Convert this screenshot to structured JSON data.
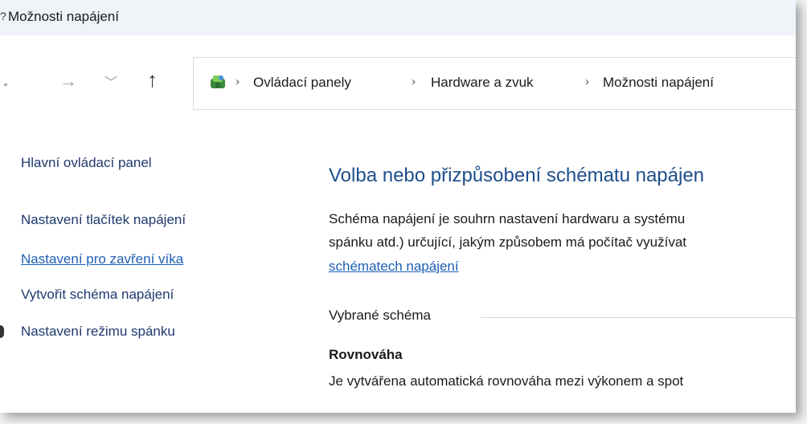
{
  "window": {
    "title": "Možnosti napájení"
  },
  "nav": {
    "back": "←",
    "forward": "→",
    "recent": "﹀",
    "up": "↑"
  },
  "breadcrumb": {
    "items": [
      "Ovládací panely",
      "Hardware a zvuk",
      "Možnosti napájení"
    ],
    "separator": "›"
  },
  "sidebar": {
    "items": [
      {
        "label": "Hlavní ovládací panel"
      },
      {
        "label": "Nastavení tlačítek napájení"
      },
      {
        "label": "Nastavení pro zavření víka"
      },
      {
        "label": "Vytvořit schéma napájení"
      },
      {
        "label": "Nastavení režimu spánku"
      }
    ]
  },
  "main": {
    "heading": "Volba nebo přizpůsobení schématu napájen",
    "paragraph_line1": "Schéma napájení je souhrn nastavení hardwaru a systému",
    "paragraph_line2": "spánku atd.) určující, jakým způsobem má počítač využívat",
    "paragraph_link": "schématech napájení",
    "group_label": "Vybrané schéma",
    "scheme_name": "Rovnováha",
    "scheme_desc": "Je vytvářena automatická rovnováha mezi výkonem a spot"
  },
  "colors": {
    "link": "#1d5fb5",
    "heading": "#1e4e8c",
    "titlebar": "#eff4f9"
  }
}
